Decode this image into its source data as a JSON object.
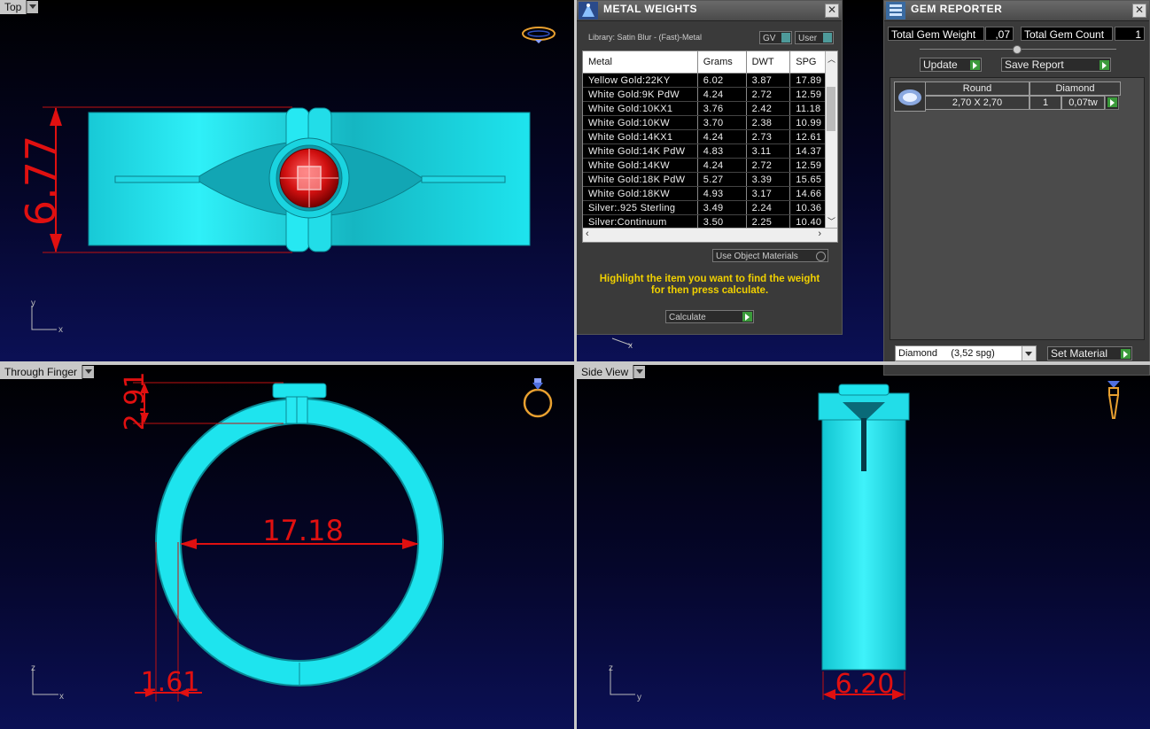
{
  "viewports": {
    "top": {
      "label": "Top",
      "dimension": "6.77",
      "axis_vertical": "y",
      "axis_horizontal": "x"
    },
    "through_finger": {
      "label": "Through Finger",
      "dimension_top": "2.91",
      "dimension_inner": "17.18",
      "dimension_bottom": "1.61",
      "axis_vertical": "z",
      "axis_horizontal": "x"
    },
    "side": {
      "label": "Side View",
      "dimension": "6.20",
      "axis_vertical": "z",
      "axis_horizontal": "y"
    },
    "back_axis": "x"
  },
  "metal_weights": {
    "title": "METAL WEIGHTS",
    "library": "Library: Satin Blur - (Fast)-Metal",
    "gv_label": "GV",
    "user_label": "User",
    "columns": [
      "Metal",
      "Grams",
      "DWT",
      "SPG"
    ],
    "rows": [
      [
        "Yellow Gold:22KY",
        "6.02",
        "3.87",
        "17.89"
      ],
      [
        "White Gold:9K PdW",
        "4.24",
        "2.72",
        "12.59"
      ],
      [
        "White Gold:10KX1",
        "3.76",
        "2.42",
        "11.18"
      ],
      [
        "White Gold:10KW",
        "3.70",
        "2.38",
        "10.99"
      ],
      [
        "White Gold:14KX1",
        "4.24",
        "2.73",
        "12.61"
      ],
      [
        "White Gold:14K PdW",
        "4.83",
        "3.11",
        "14.37"
      ],
      [
        "White Gold:14KW",
        "4.24",
        "2.72",
        "12.59"
      ],
      [
        "White Gold:18K PdW",
        "5.27",
        "3.39",
        "15.65"
      ],
      [
        "White Gold:18KW",
        "4.93",
        "3.17",
        "14.66"
      ],
      [
        "Silver:.925 Sterling",
        "3.49",
        "2.24",
        "10.36"
      ],
      [
        "Silver:Continuum",
        "3.50",
        "2.25",
        "10.40"
      ]
    ],
    "use_object_materials": "Use Object Materials",
    "instruction": "Highlight the item you want to find the weight for then press calculate.",
    "calculate": "Calculate",
    "accent_color": "#f0d000"
  },
  "gem_reporter": {
    "title": "GEM REPORTER",
    "total_weight_label": "Total Gem Weight",
    "total_weight_value": ",07",
    "total_count_label": "Total Gem Count",
    "total_count_value": "1",
    "update": "Update",
    "save_report": "Save Report",
    "gem_row": {
      "shape": "Round",
      "material": "Diamond",
      "size": "2,70 X 2,70",
      "count": "1",
      "weight": "0,07tw"
    },
    "material_select": "Diamond     (3,52 spg)",
    "set_material": "Set Material"
  },
  "colors": {
    "ring": "#19e3ee",
    "dimension": "#e01010",
    "gem": "#e02020"
  }
}
